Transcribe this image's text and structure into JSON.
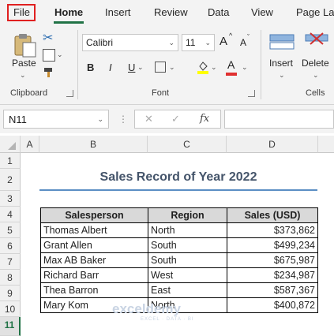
{
  "menu": {
    "items": [
      "File",
      "Home",
      "Insert",
      "Review",
      "Data",
      "View",
      "Page La"
    ],
    "active": "Home"
  },
  "ribbon": {
    "clipboard": {
      "paste_label": "Paste",
      "group_label": "Clipboard"
    },
    "font": {
      "font_name": "Calibri",
      "font_size": "11",
      "grow_label": "A",
      "shrink_label": "A",
      "bold_label": "B",
      "italic_label": "I",
      "underline_label": "U",
      "font_color_label": "A",
      "group_label": "Font",
      "fill_color": "#ffff00",
      "font_color": "#e03030"
    },
    "cells": {
      "insert_label": "Insert",
      "delete_label": "Delete",
      "group_label": "Cells"
    }
  },
  "formula_bar": {
    "name_box": "N11",
    "fx_label": "fx",
    "formula": ""
  },
  "grid": {
    "columns": [
      "A",
      "B",
      "C",
      "D"
    ],
    "rows": [
      "1",
      "2",
      "3",
      "4",
      "5",
      "6",
      "7",
      "8",
      "9",
      "10",
      "11"
    ],
    "selected_row": "11"
  },
  "sheet": {
    "title": "Sales Record of Year 2022",
    "headers": [
      "Salesperson",
      "Region",
      "Sales (USD)"
    ],
    "rows": [
      [
        "Thomas Albert",
        "North",
        "$373,862"
      ],
      [
        "Grant Allen",
        "South",
        "$499,234"
      ],
      [
        "Max AB Baker",
        "South",
        "$675,987"
      ],
      [
        "Richard Barr",
        "West",
        "$234,987"
      ],
      [
        "Thea Barron",
        "East",
        "$587,367"
      ],
      [
        "Mary Kom",
        "North",
        "$400,872"
      ]
    ]
  },
  "watermark": {
    "brand": "exceldemy",
    "tagline": "EXCEL · DATA · BI"
  },
  "colors": {
    "accent": "#217346",
    "title": "#44546a",
    "rule": "#5b8ec4",
    "highlight": "#e02020"
  }
}
